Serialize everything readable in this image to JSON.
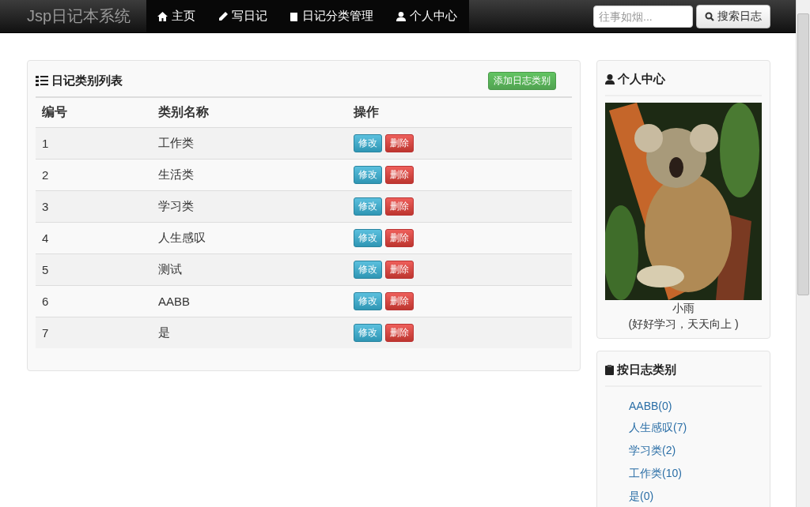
{
  "navbar": {
    "brand": "Jsp日记本系统",
    "items": [
      {
        "kind": "home",
        "label": "主页"
      },
      {
        "kind": "write",
        "label": "写日记"
      },
      {
        "kind": "category",
        "label": "日记分类管理"
      },
      {
        "kind": "profile",
        "label": "个人中心"
      }
    ],
    "search": {
      "placeholder": "往事如烟...",
      "button": "搜索日志"
    }
  },
  "category_panel": {
    "title": "日记类别列表",
    "add_button": "添加日志类别",
    "columns": [
      "编号",
      "类别名称",
      "操作"
    ],
    "rows": [
      {
        "id": "1",
        "name": "工作类",
        "edit": "修改",
        "delete": "删除"
      },
      {
        "id": "2",
        "name": "生活类",
        "edit": "修改",
        "delete": "删除"
      },
      {
        "id": "3",
        "name": "学习类",
        "edit": "修改",
        "delete": "删除"
      },
      {
        "id": "4",
        "name": "人生感叹",
        "edit": "修改",
        "delete": "删除"
      },
      {
        "id": "5",
        "name": "测试",
        "edit": "修改",
        "delete": "删除"
      },
      {
        "id": "6",
        "name": "AABB",
        "edit": "修改",
        "delete": "删除"
      },
      {
        "id": "7",
        "name": "是",
        "edit": "修改",
        "delete": "删除"
      }
    ]
  },
  "profile": {
    "title": "个人中心",
    "name": "小雨",
    "motto": "(好好学习，天天向上 )"
  },
  "categories_box": {
    "title": "按日志类别",
    "links": [
      "AABB(0)",
      "人生感叹(7)",
      "学习类(2)",
      "工作类(10)",
      "是(0)"
    ]
  }
}
